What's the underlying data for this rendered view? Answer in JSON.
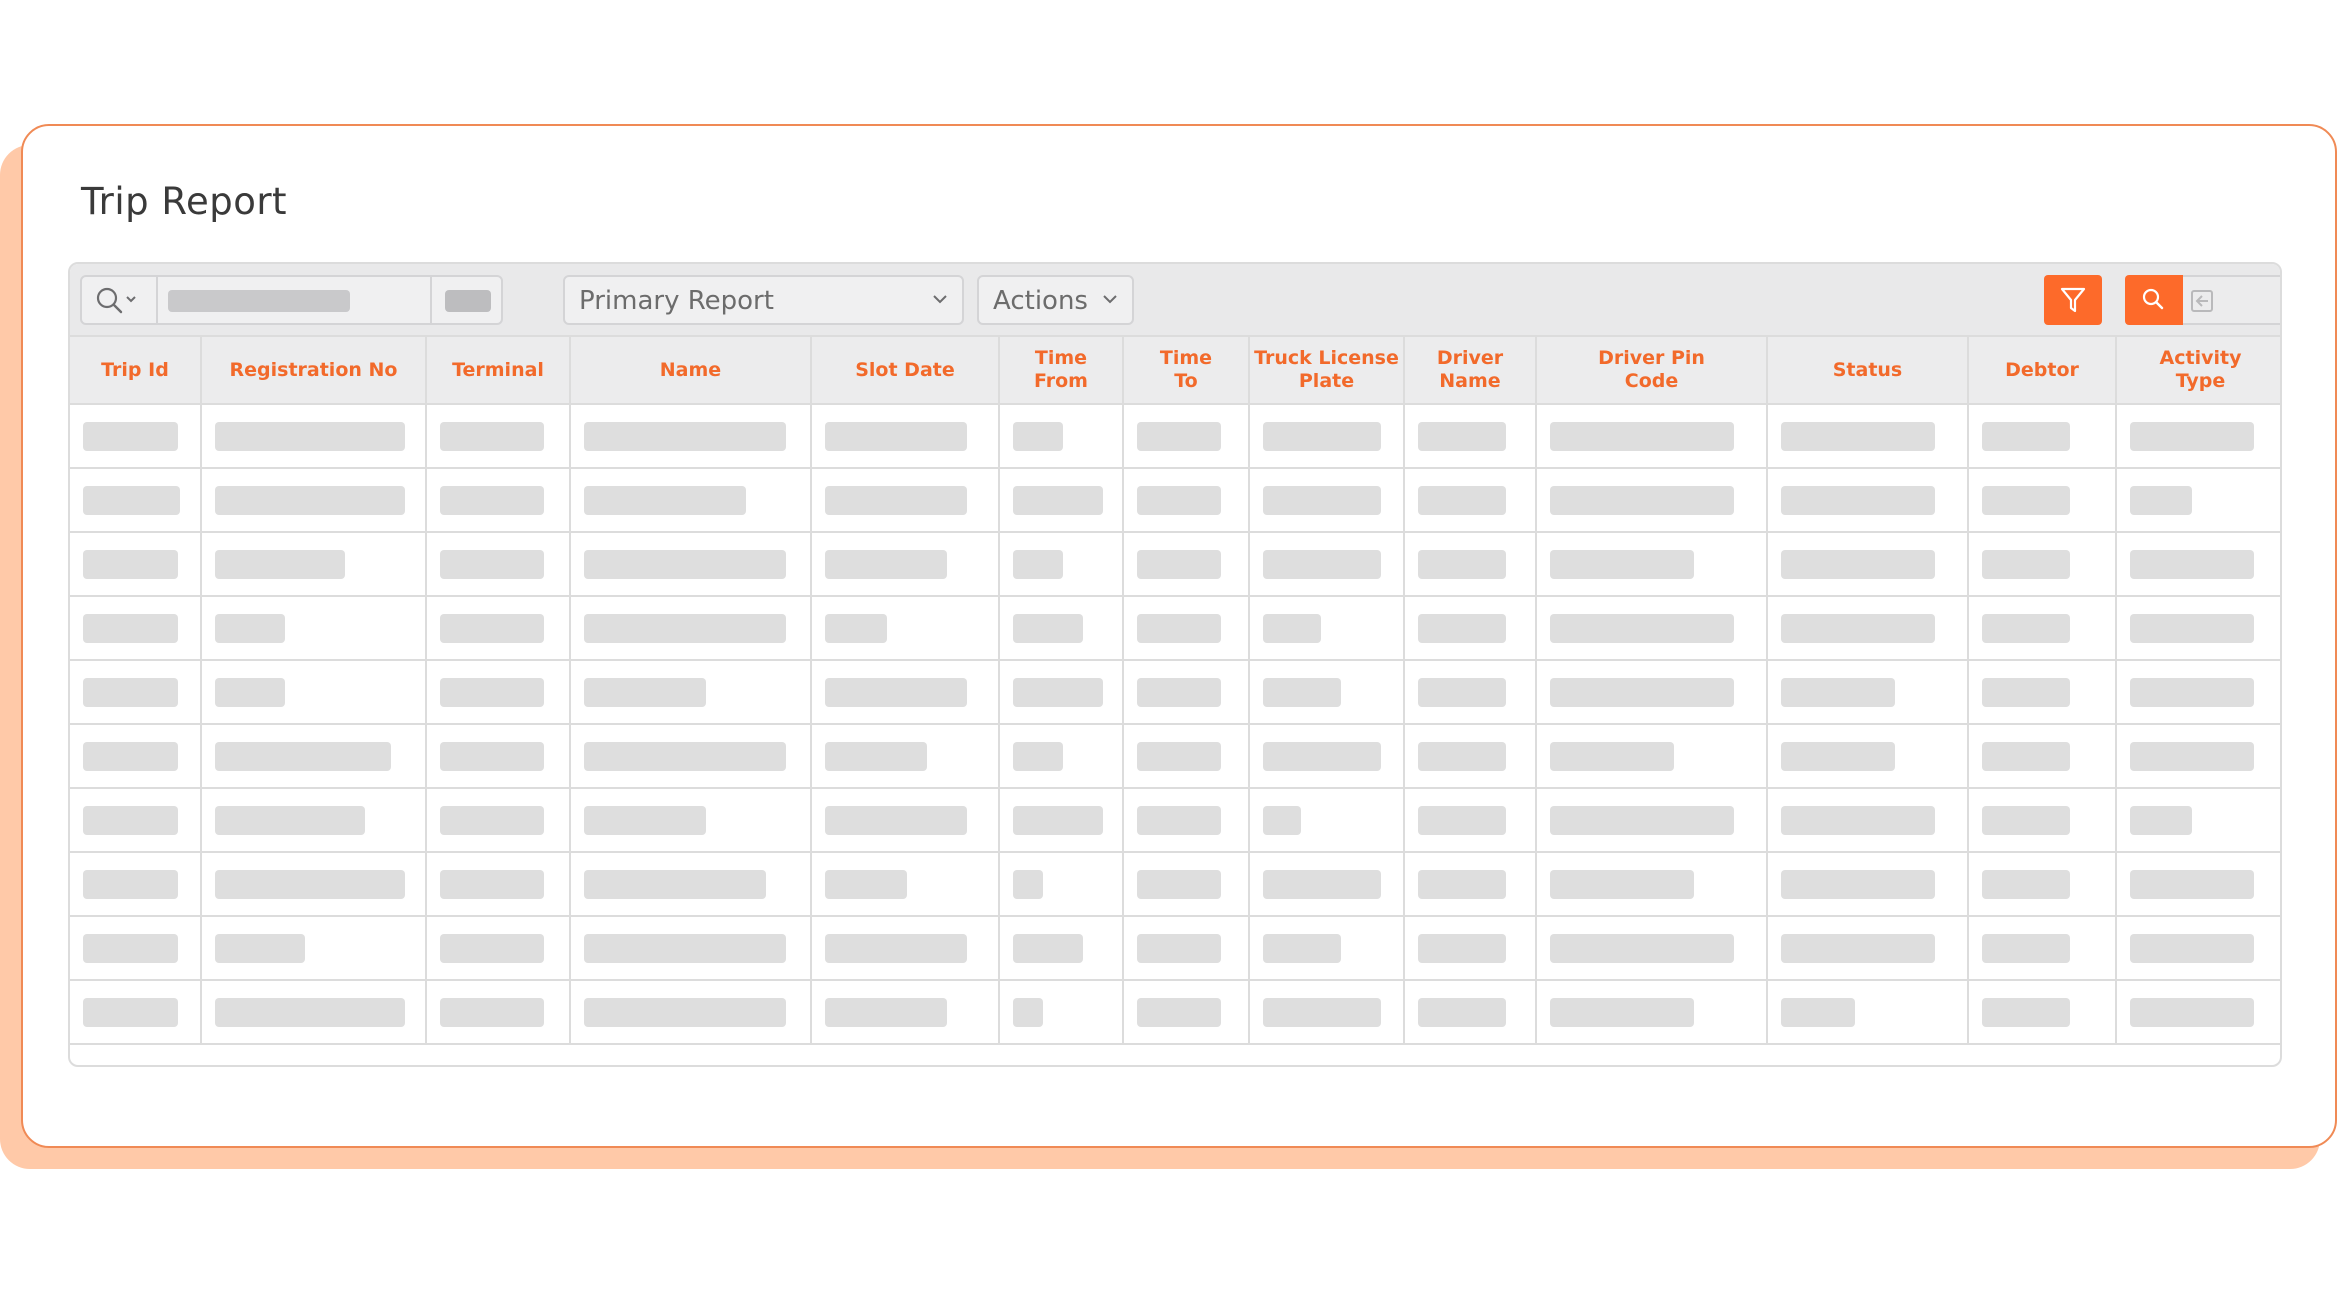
{
  "page": {
    "title": "Trip Report"
  },
  "toolbar": {
    "report_select": "Primary Report",
    "actions_select": "Actions"
  },
  "colors": {
    "accent": "#fd6a2a",
    "header_text": "#f26a2b",
    "shadow": "#ffc9a8",
    "placeholder": "#dedede"
  },
  "icons": {
    "search": "search-icon",
    "chevron": "chevron-down-icon",
    "filter": "filter-icon",
    "search_button": "search-icon",
    "export": "export-icon"
  },
  "table": {
    "columns": [
      "Trip Id",
      "Registration No",
      "Terminal",
      "Name",
      "Slot Date",
      "Time\nFrom",
      "Time\nTo",
      "Truck License\nPlate",
      "Driver\nName",
      "Driver Pin\nCode",
      "Status",
      "Debtor",
      "Activity\nType"
    ],
    "row_count": 10
  }
}
